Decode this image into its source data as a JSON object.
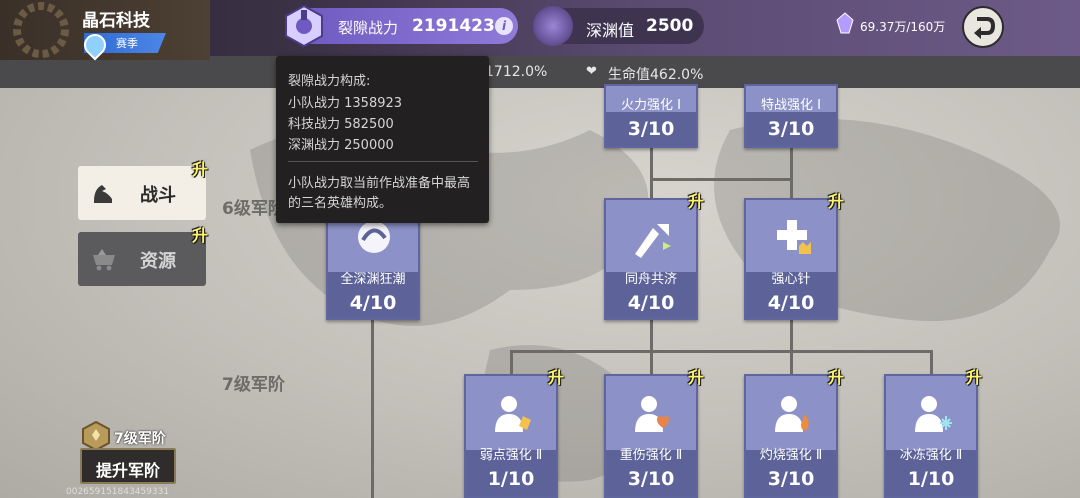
{
  "header": {
    "org_name": "晶石科技",
    "season_label": "赛季",
    "power_label": "裂隙战力",
    "power_value": "2191423",
    "info_glyph": "i",
    "abyss_label": "深渊值",
    "abyss_value": "2500",
    "crystal_text": "69.37万/160万",
    "icons": {
      "power": "gear-shield-icon",
      "abyss": "abyss-orb-icon",
      "crystal": "crystal-icon",
      "back": "back-arrow-icon",
      "season": "water-drop-icon"
    }
  },
  "stats": {
    "stat1": "1712.0%",
    "stat2_label": "生命值",
    "stat2_value": "462.0%"
  },
  "tooltip": {
    "title": "裂隙战力构成:",
    "lines": [
      "小队战力 1358923",
      "科技战力 582500",
      "深渊战力 250000"
    ],
    "note": "小队战力取当前作战准备中最高的三名英雄构成。"
  },
  "tabs": [
    {
      "label": "战斗",
      "icon": "arm-flex-icon",
      "selected": true
    },
    {
      "label": "资源",
      "icon": "mine-cart-icon",
      "selected": false
    }
  ],
  "upgrade_glyph": "升",
  "tiers": [
    "6级军阶",
    "7级军阶"
  ],
  "nodes": {
    "firepower1": {
      "name": "火力强化 Ⅰ",
      "level": "3/10"
    },
    "special1": {
      "name": "特战强化 Ⅰ",
      "level": "3/10"
    },
    "full_abyss": {
      "name": "全深渊狂潮",
      "level": "4/10"
    },
    "same_boat": {
      "name": "同舟共济",
      "level": "4/10"
    },
    "heart_shot": {
      "name": "强心针",
      "level": "4/10"
    },
    "weakpoint2": {
      "name": "弱点强化 Ⅱ",
      "level": "1/10"
    },
    "heavy_wound2": {
      "name": "重伤强化 Ⅱ",
      "level": "3/10"
    },
    "burn2": {
      "name": "灼烧强化 Ⅱ",
      "level": "3/10"
    },
    "freeze2": {
      "name": "冰冻强化 Ⅱ",
      "level": "1/10"
    }
  },
  "footer": {
    "rank_label": "7级军阶",
    "promote_label": "提升军阶",
    "uid": "002659151843459331"
  },
  "colors": {
    "node_fill": "#8c92c8",
    "node_dark": "#5d6398",
    "upgrade": "#fff36b",
    "accent": "#6e5ac0"
  }
}
